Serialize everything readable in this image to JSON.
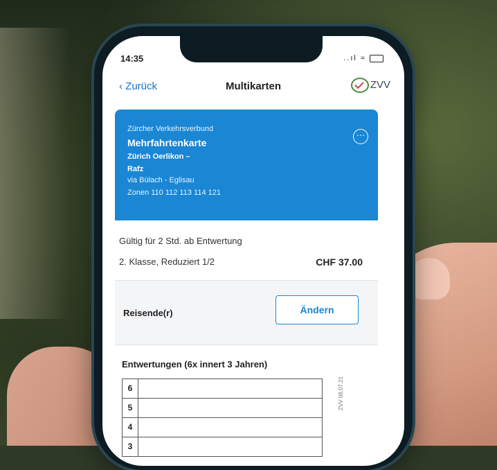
{
  "status": {
    "time": "14:35",
    "signal": "..ıl",
    "wifi": "≈"
  },
  "nav": {
    "back_label": "Zurück",
    "title": "Multikarten",
    "logo_text": "ZVV"
  },
  "ticket": {
    "operator": "Zürcher Verkehrsverbund",
    "type": "Mehrfahrtenkarte",
    "from": "Zürich Oerlikon –",
    "to": "Rafz",
    "via": "via Bülach - Eglisau",
    "zones": "Zonen 110 112 113 114 121",
    "more_icon": "⋯"
  },
  "details": {
    "validity": "Gültig für 2 Std. ab Entwertung",
    "class_info": "2. Klasse, Reduziert 1/2",
    "price": "CHF 37.00"
  },
  "travellers": {
    "label": "Reisende(r)",
    "change_button": "Ändern"
  },
  "validations": {
    "title": "Entwertungen (6x innert 3 Jahren)",
    "rows": [
      "6",
      "5",
      "4",
      "3"
    ],
    "side_text": "ZVV 08.07.21"
  },
  "colors": {
    "accent": "#1a86d4"
  }
}
